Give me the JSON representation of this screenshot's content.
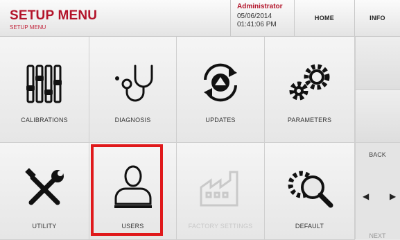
{
  "header": {
    "title": "SETUP MENU",
    "subtitle": "SETUP MENU",
    "user": "Administrator",
    "date": "05/06/2014",
    "time": "01:41:06 PM",
    "home_label": "HOME",
    "info_label": "INFO"
  },
  "tiles": [
    {
      "label": "CALIBRATIONS",
      "icon": "sliders-icon"
    },
    {
      "label": "DIAGNOSIS",
      "icon": "stethoscope-icon"
    },
    {
      "label": "UPDATES",
      "icon": "globe-refresh-icon"
    },
    {
      "label": "PARAMETERS",
      "icon": "gears-icon"
    },
    {
      "label": "UTILITY",
      "icon": "tools-icon"
    },
    {
      "label": "USERS",
      "icon": "user-icon"
    },
    {
      "label": "FACTORY SETTINGS",
      "icon": "factory-icon",
      "disabled": true
    },
    {
      "label": "DEFAULT",
      "icon": "gear-search-icon"
    }
  ],
  "nav": {
    "back_label": "BACK",
    "next_label": "NEXT"
  },
  "colors": {
    "accent": "#b3142a",
    "highlight": "#e0191b"
  }
}
